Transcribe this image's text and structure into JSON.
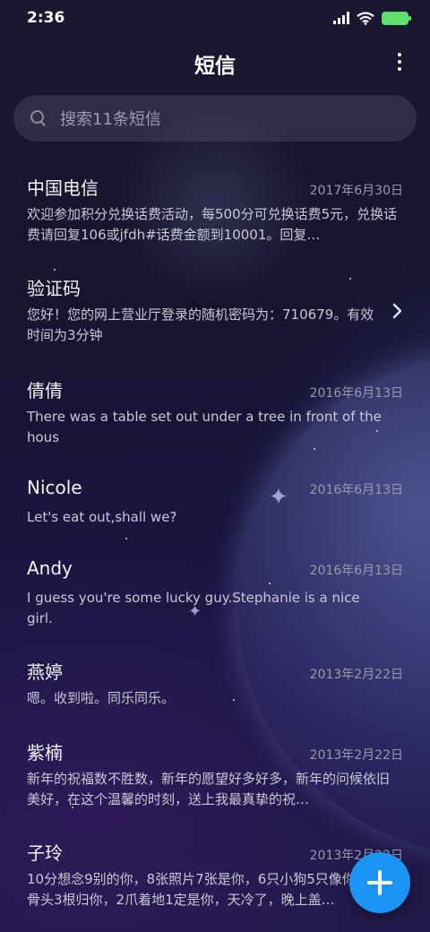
{
  "status_bar": {
    "time": "2:36",
    "icons": [
      "signal-icon",
      "wifi-icon",
      "battery-charging-icon"
    ],
    "battery_color": "#5ee06b"
  },
  "app_bar": {
    "title": "短信",
    "menu_icon": "more-vertical-icon"
  },
  "search": {
    "placeholder": "搜索11条短信",
    "icon": "search-icon"
  },
  "messages": [
    {
      "sender": "中国电信",
      "date": "2017年6月30日",
      "preview": "欢迎参加积分兑换话费活动，每500分可兑换话费5元，兑换话费请回复106或jfdh#话费金额到10001。回复…"
    },
    {
      "sender": "验证码",
      "date": "",
      "preview": "您好！您的网上营业厅登录的随机密码为：710679。有效时间为3分钟"
    },
    {
      "sender": "倩倩",
      "date": "2016年6月13日",
      "preview": "There was a table set out under a tree in front of the hous"
    },
    {
      "sender": "Nicole",
      "date": "2016年6月13日",
      "preview": "Let's eat out,shall we?"
    },
    {
      "sender": "Andy",
      "date": "2016年6月13日",
      "preview": "I guess you're some lucky guy.Stephanie is a nice girl."
    },
    {
      "sender": "燕婷",
      "date": "2013年2月22日",
      "preview": "嗯。收到啦。同乐同乐。"
    },
    {
      "sender": "紫楠",
      "date": "2013年2月22日",
      "preview": "新年的祝福数不胜数，新年的愿望好多好多，新年的问候依旧美好，在这个温馨的时刻，送上我最真挚的祝…"
    },
    {
      "sender": "子玲",
      "date": "2013年2月22日",
      "preview": "10分想念9别的你，8张照片7张是你，6只小狗5只像你，4根骨头3根归你，2爪着地1定是你，天冷了，晚上盖…"
    }
  ],
  "fab": {
    "icon": "plus-icon",
    "color": "#1a95f5"
  }
}
